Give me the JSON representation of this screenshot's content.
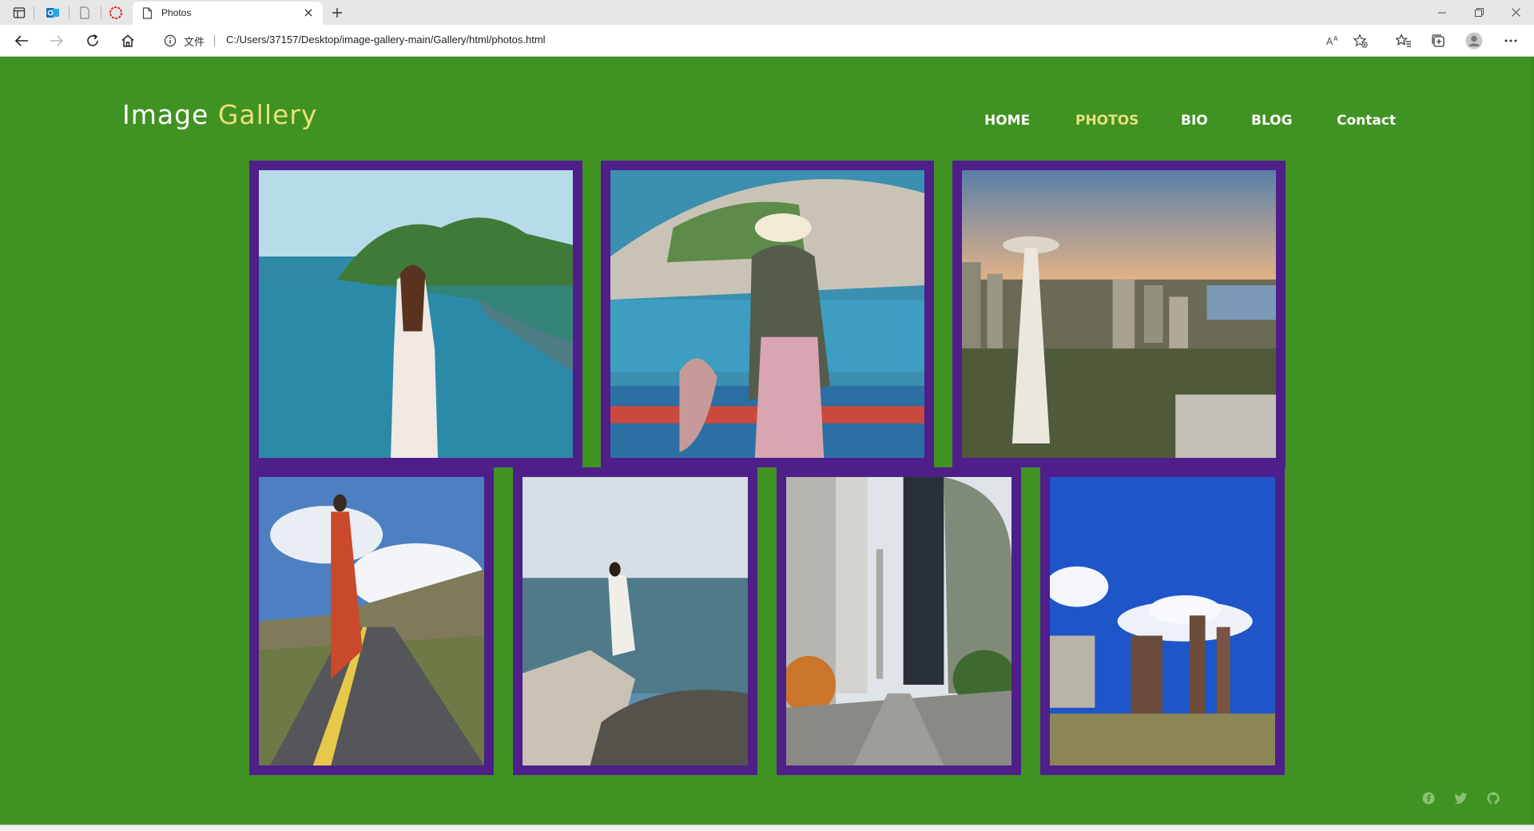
{
  "browser": {
    "tab_title": "Photos",
    "address_label": "文件",
    "url": "C:/Users/37157/Desktop/image-gallery-main/Gallery/html/photos.html",
    "icons": {
      "sidebar": "sidebar-toggle-icon",
      "outlook": "outlook-icon",
      "blank_page": "page-icon",
      "opera": "circle-icon",
      "new_tab": "plus-icon",
      "read_aloud": "read-aloud-icon",
      "add_favorite": "star-add-icon",
      "favorites": "favorites-icon",
      "collections": "collections-icon",
      "profile": "avatar-icon",
      "more": "more-icon"
    }
  },
  "site": {
    "logo_part1": "Image",
    "logo_part2": "Gallery",
    "accent_color": "#e9e07a",
    "background_color": "#409222",
    "frame_color": "#4e1f8a",
    "nav": [
      {
        "label": "HOME",
        "active": false
      },
      {
        "label": "PHOTOS",
        "active": true
      },
      {
        "label": "BIO",
        "active": false
      },
      {
        "label": "BLOG",
        "active": false
      },
      {
        "label": "Contact",
        "active": false
      }
    ],
    "photos": [
      "woman-in-white-dress-looking-at-sea-island",
      "traveler-with-backpack-on-fishing-boat",
      "city-skyline-with-space-needle-at-sunset",
      "woman-in-red-dress-on-mountain-road",
      "woman-sitting-on-rock-by-sea",
      "city-street-with-skyscrapers-and-sphere",
      "industrial-park-towers-under-blue-sky"
    ],
    "social": [
      "facebook-icon",
      "twitter-icon",
      "github-icon"
    ]
  }
}
